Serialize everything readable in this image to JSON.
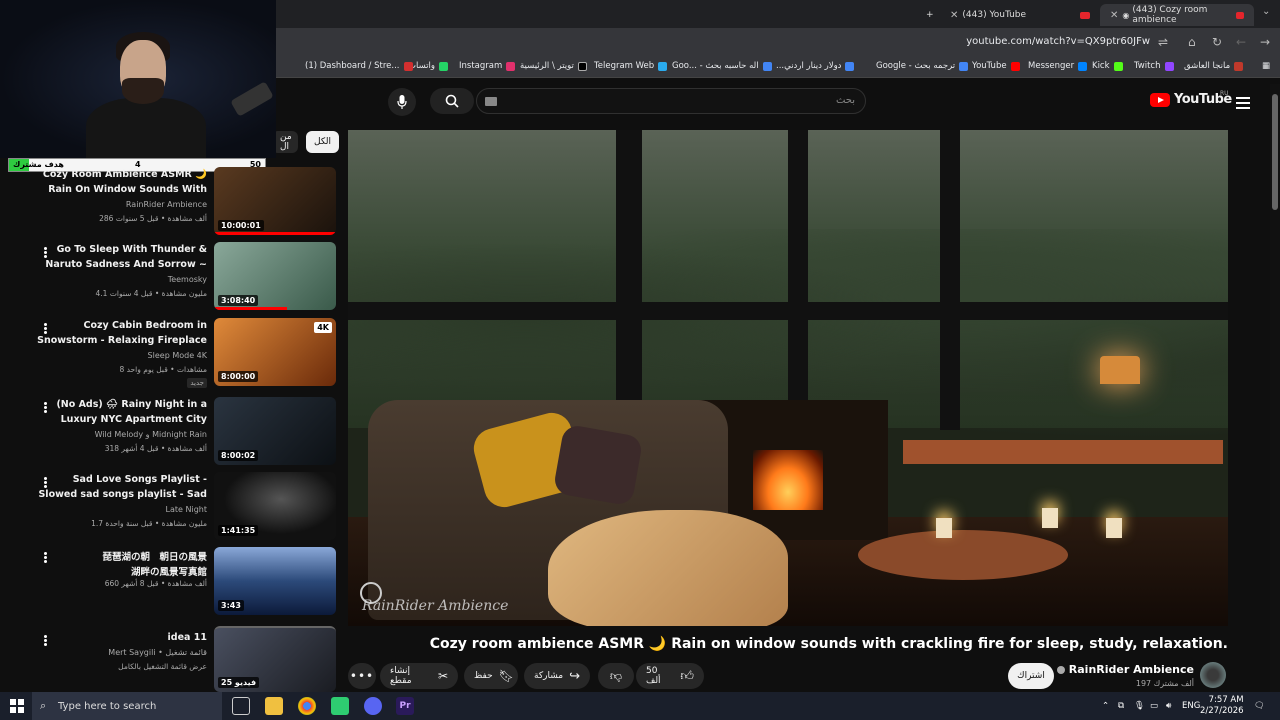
{
  "browser": {
    "tabs": [
      {
        "title": "(443) YouTube"
      },
      {
        "title": "(443) Cozy room ambience"
      }
    ],
    "new_tab": "+",
    "url": "youtube.com/watch?v=QX9ptr60JFw",
    "bookmarks": [
      {
        "label": "مانجا العاشق",
        "color": "#c0392b"
      },
      {
        "label": "Twitch",
        "color": "#9146ff"
      },
      {
        "label": "Kick",
        "color": "#53fc18"
      },
      {
        "label": "Messenger",
        "color": "#0084ff"
      },
      {
        "label": "YouTube",
        "color": "#ff0000"
      },
      {
        "label": "Google - ترجمه بحث",
        "color": "#4285f4"
      },
      {
        "label": "...دولار دينار اردني",
        "color": "#4285f4"
      },
      {
        "label": "Goo... - اله حاسبه بحث",
        "color": "#4285f4"
      },
      {
        "label": "Telegram Web",
        "color": "#2aabee"
      },
      {
        "label": "تويتر \\ الرئيسية",
        "color": "#000000"
      },
      {
        "label": "Instagram",
        "color": "#e1306c"
      },
      {
        "label": "واتساب",
        "color": "#25d366"
      },
      {
        "label": "(1) Dashboard / Stre...",
        "color": "#d32f2f"
      }
    ]
  },
  "stream_overlay": {
    "goal_label": "هدف مشترك",
    "current": "4",
    "target": "50",
    "progress_fraction": 0.08
  },
  "header": {
    "logo_text": "YouTube",
    "region": "RU",
    "search_placeholder": "بحث"
  },
  "chips": [
    {
      "label": "الكل",
      "active": true
    },
    {
      "label": "من ال",
      "active": false
    }
  ],
  "video": {
    "title": "Cozy room ambience ASMR 🌙 Rain on window sounds with crackling fire for sleep, study, relaxation.",
    "watermark": "RainRider Ambience",
    "channel": "RainRider Ambience",
    "subscribers": "197 ألف مشترك",
    "subscribe_label": "اشتراك",
    "likes": "50 ألف",
    "share_label": "مشاركة",
    "save_label": "حفظ",
    "clip_label": "إنشاء مقطع"
  },
  "recommended": [
    {
      "t1": "Cozy Room Ambience ASMR 🌙",
      "t2": "Rain On Window Sounds With",
      "channel": "RainRider Ambience",
      "meta": "286 ألف مشاهدة • قبل 5 سنوات",
      "duration": "10:00:01",
      "progress": 1.0,
      "thumb": "#3a2a1c"
    },
    {
      "t1": "Go To Sleep With Thunder &",
      "t2": "Naruto Sadness And Sorrow ~",
      "channel": "Teemosky",
      "meta": "4.1 مليون مشاهدة • قبل 4 سنوات",
      "duration": "3:08:40",
      "progress": 0.6,
      "thumb": "#6a8a7a"
    },
    {
      "t1": "Cozy Cabin Bedroom in",
      "t2": "Snowstorm - Relaxing Fireplace",
      "channel": "Sleep Mode 4K",
      "meta": "8 مشاهدات • قبل يوم واحد",
      "duration": "8:00:00",
      "progress": 0,
      "thumb": "#b5642a",
      "new": "جديد"
    },
    {
      "t1": "(No Ads) 🌧 Rainy Night in a",
      "t2": "Luxury NYC Apartment  City",
      "channel": "Wild Melody و Midnight Rain",
      "meta": "318 ألف مشاهدة • قبل 4 أشهر",
      "duration": "8:00:02",
      "progress": 0,
      "thumb": "#1c2430"
    },
    {
      "t1": "Sad Love Songs Playlist -",
      "t2": "Slowed sad songs playlist - Sad",
      "channel": "Late Night",
      "meta": "1.7 مليون مشاهدة • قبل سنة واحدة",
      "duration": "1:41:35",
      "progress": 0,
      "thumb": "#222222"
    },
    {
      "t1": "琵琶湖の朝　朝日の風景",
      "t2": "湖畔の風景写真館",
      "channel": "",
      "meta": "660 ألف مشاهدة • قبل 8 أشهر",
      "duration": "3:43",
      "progress": 0,
      "thumb": "#2c4a7a"
    },
    {
      "t1": "idea 11",
      "t2": "",
      "channel": "Mert Saygili • قائمة تشغيل",
      "meta": "عرض قائمة التشغيل بالكامل",
      "duration": "25 فيديو",
      "progress": 0,
      "thumb": "#30343c"
    }
  ],
  "taskbar": {
    "search_placeholder": "Type here to search",
    "lang": "ENG",
    "time": "7:57 AM",
    "date": "2/27/2026"
  }
}
